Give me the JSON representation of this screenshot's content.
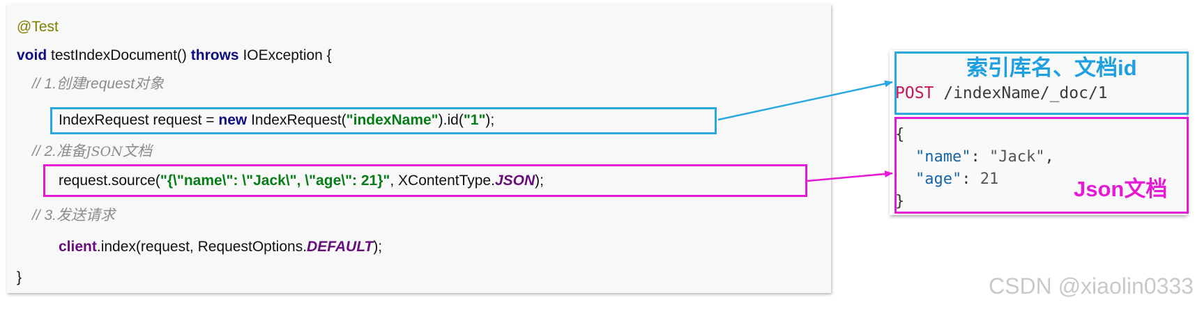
{
  "code": {
    "annotation": "@Test",
    "line2": {
      "kw_void": "void",
      "method": " testIndexDocument() ",
      "kw_throws": "throws",
      "rest": " IOException {"
    },
    "comment1": "// 1.创建request对象",
    "line4": {
      "a": "IndexRequest request = ",
      "kw_new": "new",
      "b": " IndexRequest(",
      "s1": "\"indexName\"",
      "c": ").id(",
      "s2": "\"1\"",
      "d": ");"
    },
    "comment2": {
      "prefix": "// 2.准备",
      "json": "JSON",
      "suffix": "文档"
    },
    "line6": {
      "a": "request.source(",
      "s": "\"{\\\"name\\\": \\\"Jack\\\", \\\"age\\\": 21}\"",
      "b": ", XContentType.",
      "f": "JSON",
      "c": ");"
    },
    "comment3": "// 3.发送请求",
    "line8": {
      "client": "client",
      "a": ".index(request, RequestOptions.",
      "f": "DEFAULT",
      "b": ");"
    },
    "close": "}"
  },
  "request": {
    "head_label": "索引库名、文档id",
    "method": "POST",
    "path": " /indexName/_doc/1",
    "json_open": "{",
    "json_line1": {
      "key": "\"name\"",
      "sep": ": ",
      "val": "\"Jack\"",
      "end": ","
    },
    "json_line2": {
      "key": "\"age\"",
      "sep": ": ",
      "val": "21"
    },
    "json_close": "}",
    "json_label": "Json文档"
  },
  "colors": {
    "blue_box": "#29a8e0",
    "pink_box": "#e619d6",
    "keyword": "#0e0e84",
    "string": "#067d17"
  },
  "watermark": "CSDN @xiaolin0333"
}
